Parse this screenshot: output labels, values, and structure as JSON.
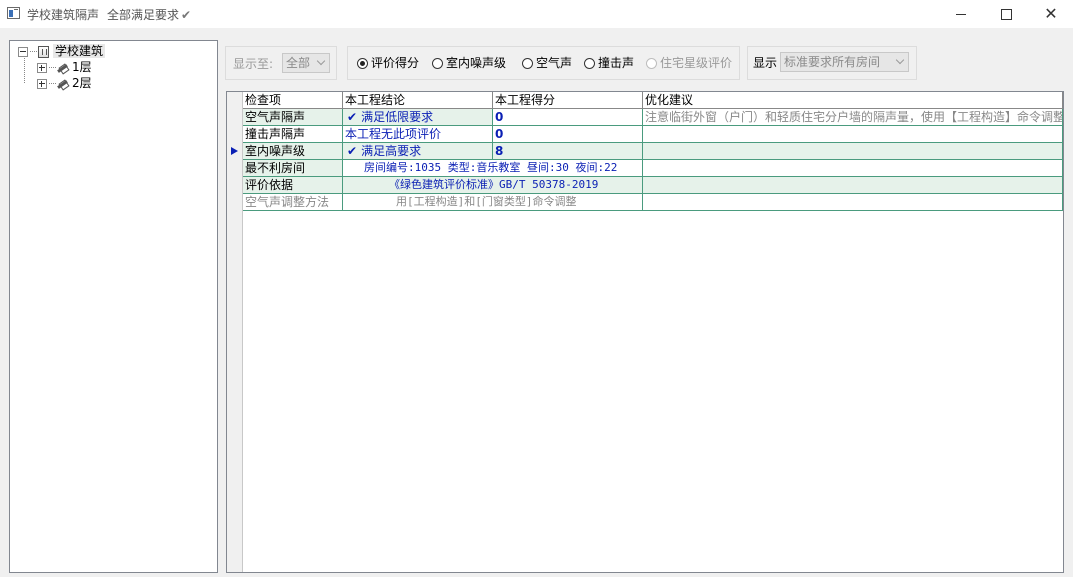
{
  "window": {
    "title": "学校建筑隔声",
    "status": "全部满足要求",
    "status_check": "✔"
  },
  "tree": {
    "root": "学校建筑",
    "children": [
      "1层",
      "2层"
    ]
  },
  "toolbar": {
    "show_to_label": "显示至:",
    "show_to_value": "全部",
    "radios": [
      "评价得分",
      "室内噪声级",
      "空气声",
      "撞击声",
      "住宅星级评价"
    ],
    "radio_selected": "评价得分",
    "display_label": "显示",
    "display_value": "标准要求所有房间"
  },
  "grid": {
    "headers": [
      "检查项",
      "本工程结论",
      "本工程得分",
      "优化建议"
    ],
    "rows": [
      {
        "item": "空气声隔声",
        "check": "✔",
        "conclusion": "满足低限要求",
        "score": "0",
        "advice": "注意临街外窗（户门）和轻质住宅分户墙的隔声量，使用【工程构造】命令调整"
      },
      {
        "item": "撞击声隔声",
        "check": "",
        "conclusion": "本工程无此项评价",
        "score": "0",
        "advice": ""
      },
      {
        "item": "室内噪声级",
        "check": "✔",
        "conclusion": "满足高要求",
        "score": "8",
        "advice": ""
      },
      {
        "item": "最不利房间",
        "merged": "房间编号:1035 类型:音乐教室 昼间:30 夜间:22"
      },
      {
        "item": "评价依据",
        "merged": "《绿色建筑评价标准》GB/T 50378-2019"
      },
      {
        "item": "空气声调整方法",
        "merged": "用[工程构造]和[门窗类型]命令调整"
      }
    ]
  }
}
